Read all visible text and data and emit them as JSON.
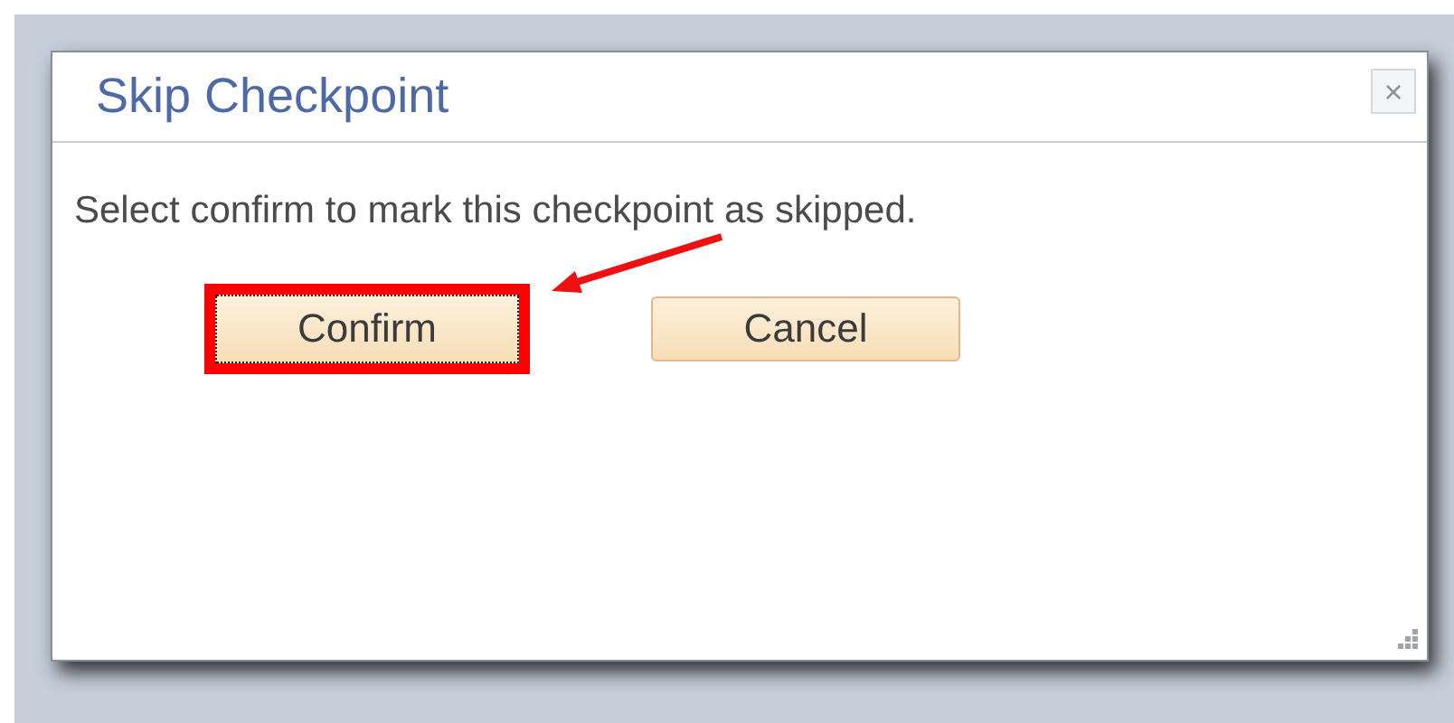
{
  "dialog": {
    "title": "Skip Checkpoint",
    "close": "×",
    "message": "Select confirm to mark this checkpoint as skipped.",
    "buttons": [
      {
        "label": "Confirm",
        "focused": true,
        "highlighted": true
      },
      {
        "label": "Cancel",
        "focused": false,
        "highlighted": false
      }
    ]
  }
}
